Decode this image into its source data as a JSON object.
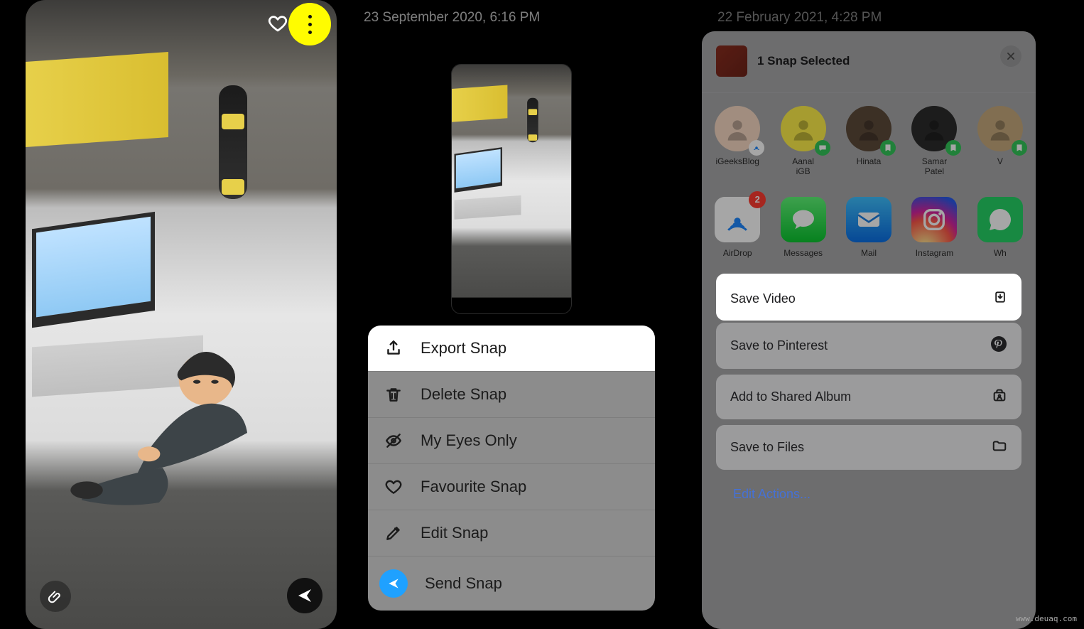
{
  "screen1": {
    "more_button_name": "more-options",
    "heart_name": "favorite-heart-icon"
  },
  "screen2": {
    "timestamp": "23 September 2020, 6:16 PM",
    "menu": {
      "export": "Export Snap",
      "delete": "Delete Snap",
      "eyes": "My Eyes Only",
      "favourite": "Favourite Snap",
      "edit": "Edit Snap",
      "send": "Send Snap"
    }
  },
  "screen3": {
    "timestamp": "22 February 2021, 4:28 PM",
    "header_title": "1 Snap Selected",
    "contacts": [
      {
        "name": "iGeeksBlog",
        "badge": "airdrop",
        "bg": "#f7d9c4"
      },
      {
        "name": "Aanal iGB",
        "badge": "messages",
        "bg": "#fff04a"
      },
      {
        "name": "Hinata",
        "badge": "whatsapp",
        "bg": "#5d4a3a"
      },
      {
        "name": "Samar Patel",
        "badge": "whatsapp",
        "bg": "#2b2b2b"
      },
      {
        "name": "V",
        "badge": "whatsapp",
        "bg": "#c6a97d"
      }
    ],
    "apps": [
      {
        "name": "AirDrop",
        "type": "airdrop",
        "badge": "2"
      },
      {
        "name": "Messages",
        "type": "messages"
      },
      {
        "name": "Mail",
        "type": "mail"
      },
      {
        "name": "Instagram",
        "type": "instagram"
      },
      {
        "name": "Wh",
        "type": "whatsapp"
      }
    ],
    "actions": {
      "save_video": "Save Video",
      "pinterest": "Save to Pinterest",
      "shared_album": "Add to Shared Album",
      "files": "Save to Files",
      "edit_actions": "Edit Actions..."
    }
  },
  "watermark": "www.deuaq.com"
}
